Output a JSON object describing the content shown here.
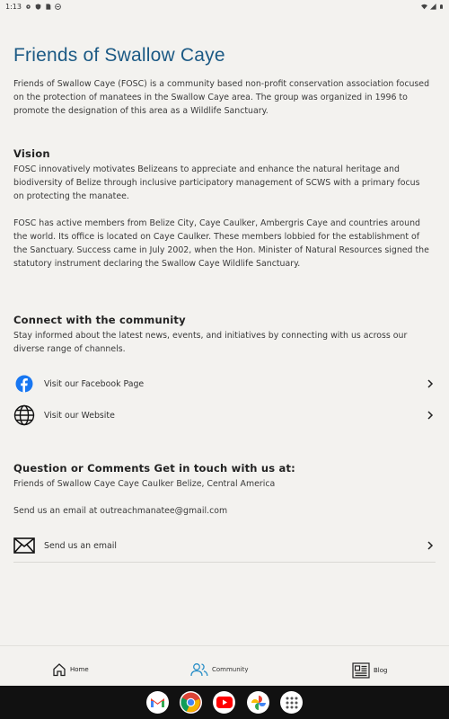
{
  "status_bar": {
    "time": "1:13"
  },
  "page": {
    "title": "Friends of Swallow Caye",
    "intro": "Friends of Swallow Caye (FOSC) is a community based non-profit conservation association focused on the protection of manatees in the Swallow Caye area. The group was organized in 1996 to promote the designation of this area as a Wildlife Sanctuary.",
    "vision_heading": "Vision",
    "vision_text": "FOSC innovatively motivates Belizeans to appreciate and enhance the natural heritage and biodiversity of Belize through inclusive participatory management of SCWS with a primary focus on protecting the manatee.",
    "members_text": "FOSC has active members from Belize City, Caye Caulker, Ambergris Caye and countries around the world. Its office is located on Caye Caulker. These members lobbied for the establishment of the Sanctuary. Success came in July 2002, when the Hon. Minister of Natural Resources signed the statutory instrument declaring the Swallow Caye Wildlife Sanctuary.",
    "connect_heading": "Connect with the community",
    "connect_text": "Stay informed about the latest news, events, and initiatives by connecting with us across our diverse range of channels.",
    "links": [
      {
        "label": "Visit our Facebook Page",
        "icon": "facebook-icon"
      },
      {
        "label": "Visit our Website",
        "icon": "globe-icon"
      }
    ],
    "contact_heading": "Question or Comments Get in touch with us at:",
    "address": "Friends of Swallow Caye Caye Caulker Belize, Central America",
    "email_text": "Send us an email at outreachmanatee@gmail.com",
    "email_link": {
      "label": "Send us an email",
      "icon": "envelope-icon"
    }
  },
  "bottom_nav": [
    {
      "label": "Home",
      "icon": "home-icon",
      "active": false
    },
    {
      "label": "Community",
      "icon": "community-icon",
      "active": true
    },
    {
      "label": "Blog",
      "icon": "newspaper-icon",
      "active": false
    }
  ],
  "dock_apps": [
    "gmail-icon",
    "chrome-icon",
    "youtube-icon",
    "photos-icon",
    "app-drawer-icon"
  ],
  "colors": {
    "title": "#1c5a85",
    "background": "#f3f2ef",
    "active_nav": "#2a8fc7",
    "facebook": "#1877f2"
  }
}
